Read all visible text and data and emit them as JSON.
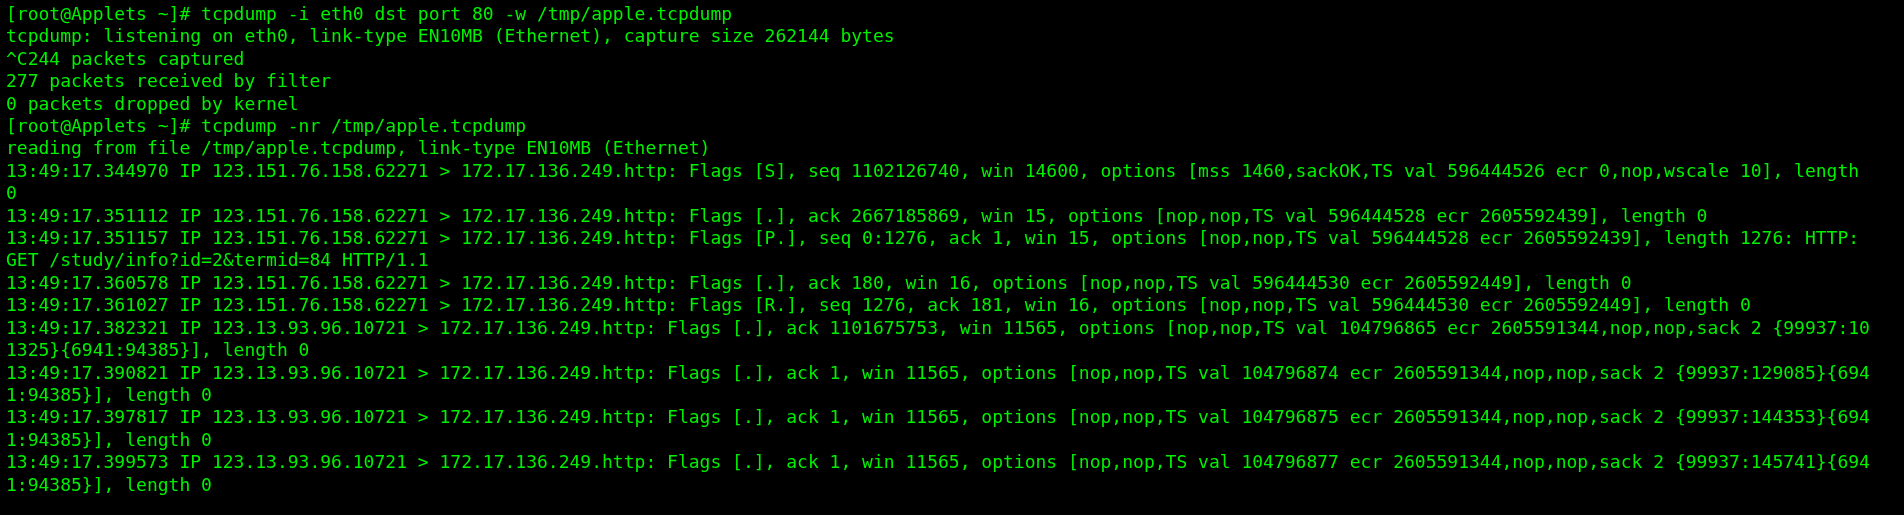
{
  "terminal": {
    "lines": [
      "[root@Applets ~]# tcpdump -i eth0 dst port 80 -w /tmp/apple.tcpdump",
      "tcpdump: listening on eth0, link-type EN10MB (Ethernet), capture size 262144 bytes",
      "^C244 packets captured",
      "277 packets received by filter",
      "0 packets dropped by kernel",
      "[root@Applets ~]# tcpdump -nr /tmp/apple.tcpdump",
      "reading from file /tmp/apple.tcpdump, link-type EN10MB (Ethernet)",
      "13:49:17.344970 IP 123.151.76.158.62271 > 172.17.136.249.http: Flags [S], seq 1102126740, win 14600, options [mss 1460,sackOK,TS val 596444526 ecr 0,nop,wscale 10], length",
      "0",
      "13:49:17.351112 IP 123.151.76.158.62271 > 172.17.136.249.http: Flags [.], ack 2667185869, win 15, options [nop,nop,TS val 596444528 ecr 2605592439], length 0",
      "13:49:17.351157 IP 123.151.76.158.62271 > 172.17.136.249.http: Flags [P.], seq 0:1276, ack 1, win 15, options [nop,nop,TS val 596444528 ecr 2605592439], length 1276: HTTP:",
      "GET /study/info?id=2&termid=84 HTTP/1.1",
      "13:49:17.360578 IP 123.151.76.158.62271 > 172.17.136.249.http: Flags [.], ack 180, win 16, options [nop,nop,TS val 596444530 ecr 2605592449], length 0",
      "13:49:17.361027 IP 123.151.76.158.62271 > 172.17.136.249.http: Flags [R.], seq 1276, ack 181, win 16, options [nop,nop,TS val 596444530 ecr 2605592449], length 0",
      "13:49:17.382321 IP 123.13.93.96.10721 > 172.17.136.249.http: Flags [.], ack 1101675753, win 11565, options [nop,nop,TS val 104796865 ecr 2605591344,nop,nop,sack 2 {99937:10",
      "1325}{6941:94385}], length 0",
      "13:49:17.390821 IP 123.13.93.96.10721 > 172.17.136.249.http: Flags [.], ack 1, win 11565, options [nop,nop,TS val 104796874 ecr 2605591344,nop,nop,sack 2 {99937:129085}{694",
      "1:94385}], length 0",
      "13:49:17.397817 IP 123.13.93.96.10721 > 172.17.136.249.http: Flags [.], ack 1, win 11565, options [nop,nop,TS val 104796875 ecr 2605591344,nop,nop,sack 2 {99937:144353}{694",
      "1:94385}], length 0",
      "13:49:17.399573 IP 123.13.93.96.10721 > 172.17.136.249.http: Flags [.], ack 1, win 11565, options [nop,nop,TS val 104796877 ecr 2605591344,nop,nop,sack 2 {99937:145741}{694",
      "1:94385}], length 0"
    ]
  }
}
